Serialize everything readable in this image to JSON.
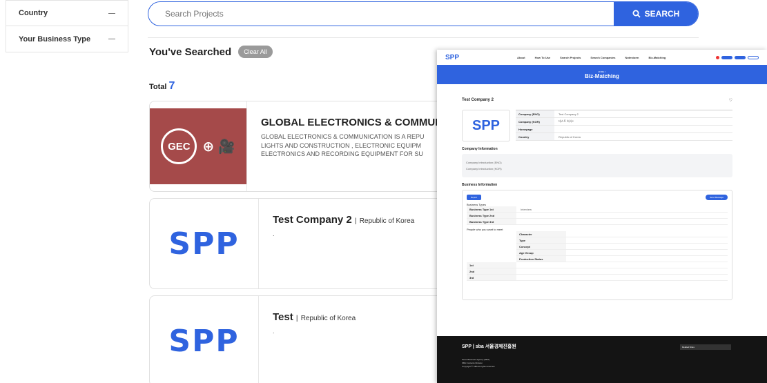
{
  "filters": [
    {
      "label": "Country"
    },
    {
      "label": "Your Business Type"
    }
  ],
  "search": {
    "placeholder": "Search Projects",
    "button_label": "SEARCH"
  },
  "searched": {
    "title": "You've Searched",
    "clear_label": "Clear All"
  },
  "total": {
    "label": "Total",
    "count": "7"
  },
  "results": [
    {
      "title": "GLOBAL ELECTRONICS & COMMUNI",
      "logo_text": "GEC",
      "desc_lines": [
        "GLOBAL ELECTRONICS & COMMUNICATION IS A REPU",
        "LIGHTS AND CONSTRUCTION , ELECTRONIC EQUIPM",
        "ELECTRONICS AND RECORDING EQUIPMENT FOR SU"
      ]
    },
    {
      "title": "Test Company 2",
      "separator": "|",
      "country": "Republic of Korea",
      "desc": ".",
      "logo_text": "SPP"
    },
    {
      "title": "Test",
      "separator": "|",
      "country": "Republic of Korea",
      "desc": ".",
      "logo_text": "SPP"
    }
  ],
  "overlay": {
    "logo": "SPP",
    "nav": [
      "About",
      "How To Use",
      "Search Projects",
      "Search Companies",
      "Notestorm",
      "Biz-Matching"
    ],
    "banner_small": "HOME >",
    "banner_title": "Biz-Matching",
    "company_title": "Test Company 2",
    "logo_box": "SPP",
    "profile_rows": [
      {
        "k": "Company (ENG)",
        "v": "Test Company 2"
      },
      {
        "k": "Company (KOR)",
        "v": "테스트 회사2"
      },
      {
        "k": "Homepage",
        "v": ""
      },
      {
        "k": "Country",
        "v": "Republic of Korea"
      }
    ],
    "company_info_title": "Company Information",
    "company_info_items": [
      "Company Introduction (ENG)",
      "Company Introduction (KOR)"
    ],
    "business_info_title": "Business Information",
    "report_label": "Report",
    "send_label": "Send Message",
    "business_types_label": "Business Types",
    "business_rows": [
      {
        "k": "Business Type 1st",
        "v": "Interview"
      },
      {
        "k": "Business Type 2nd",
        "v": ""
      },
      {
        "k": "Business Type 3rd",
        "v": ""
      }
    ],
    "people_label": "People who you want to meet",
    "people_rows": [
      {
        "k": "Character",
        "v": ""
      },
      {
        "k": "Type",
        "v": ""
      },
      {
        "k": "Concept",
        "v": ""
      },
      {
        "k": "Age Group",
        "v": ""
      },
      {
        "k": "Production Status",
        "v": ""
      }
    ],
    "people_groups": [
      "1st",
      "2nd",
      "3rd"
    ],
    "footer_brand": "SPP | sba 서울경제진흥원",
    "footer_select": "Related Sites",
    "footer_lines": [
      "Seoul Business Agency (SBA)",
      "SBA Contents Division",
      "Copyright © SBA All rights reserved."
    ]
  }
}
